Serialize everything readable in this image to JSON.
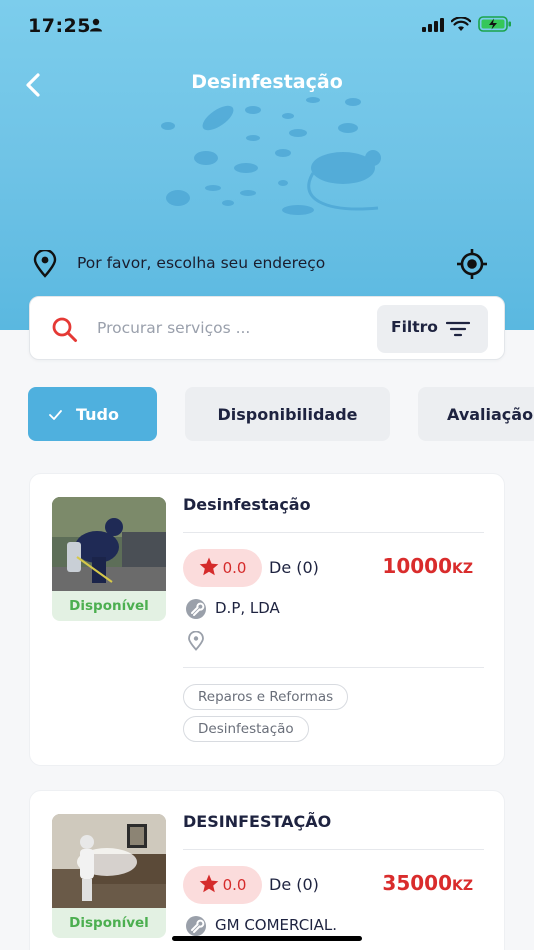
{
  "status_bar": {
    "time": "17:25"
  },
  "header": {
    "title": "Desinfestação"
  },
  "address": {
    "prompt": "Por favor, escolha seu endereço"
  },
  "search": {
    "placeholder": "Procurar serviços ...",
    "filter_label": "Filtro"
  },
  "filters": {
    "chips": [
      {
        "label": "Tudo",
        "selected": true
      },
      {
        "label": "Disponibilidade",
        "selected": false
      },
      {
        "label": "Avaliação",
        "selected": false
      }
    ]
  },
  "services": [
    {
      "title": "Desinfestação",
      "rating": "0.0",
      "rating_count": "De (0)",
      "price": "10000",
      "currency": "KZ",
      "availability": "Disponível",
      "provider": "D.P, LDA",
      "tags": [
        "Reparos e Reformas",
        "Desinfestação"
      ]
    },
    {
      "title": "DESINFESTAÇÃO",
      "rating": "0.0",
      "rating_count": "De (0)",
      "price": "35000",
      "currency": "KZ",
      "availability": "Disponível",
      "provider": "GM COMERCIAL."
    }
  ],
  "colors": {
    "header_bg": "#6fc3e6",
    "accent": "#4fb0de",
    "price": "#d92c2c",
    "available": "#4caf50",
    "rating_bg": "#fbdcdc"
  }
}
